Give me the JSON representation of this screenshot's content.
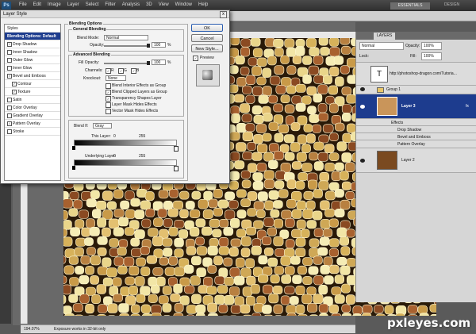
{
  "app": {
    "logo": "Ps",
    "menu": [
      "File",
      "Edit",
      "Image",
      "Layer",
      "Select",
      "Filter",
      "Analysis",
      "3D",
      "View",
      "Window",
      "Help"
    ],
    "workspace_active": "ESSENTIALS",
    "workspace_other": "DESIGN"
  },
  "status": {
    "zoom": "194.07%",
    "message": "Exposure works in 32-bit only"
  },
  "dialog": {
    "title": "Layer Style",
    "close": "x",
    "styles_header": "Styles",
    "styles": [
      {
        "label": "Blending Options: Default",
        "checked": null,
        "selected": true
      },
      {
        "label": "Drop Shadow",
        "checked": true
      },
      {
        "label": "Inner Shadow",
        "checked": false
      },
      {
        "label": "Outer Glow",
        "checked": false
      },
      {
        "label": "Inner Glow",
        "checked": false
      },
      {
        "label": "Bevel and Emboss",
        "checked": true
      },
      {
        "label": "Contour",
        "checked": true,
        "indent": true
      },
      {
        "label": "Texture",
        "checked": true,
        "indent": true
      },
      {
        "label": "Satin",
        "checked": false
      },
      {
        "label": "Color Overlay",
        "checked": false
      },
      {
        "label": "Gradient Overlay",
        "checked": false
      },
      {
        "label": "Pattern Overlay",
        "checked": true
      },
      {
        "label": "Stroke",
        "checked": false
      }
    ],
    "blending_options_title": "Blending Options",
    "general_title": "General Blending",
    "blend_mode_label": "Blend Mode:",
    "blend_mode_value": "Normal",
    "opacity_label": "Opacity:",
    "opacity_value": "100",
    "percent": "%",
    "advanced_title": "Advanced Blending",
    "fill_opacity_label": "Fill Opacity:",
    "fill_opacity_value": "100",
    "channels_label": "Channels:",
    "channels": [
      "R",
      "G",
      "B"
    ],
    "knockout_label": "Knockout:",
    "knockout_value": "None",
    "advanced_checks": [
      {
        "label": "Blend Interior Effects as Group",
        "checked": false
      },
      {
        "label": "Blend Clipped Layers as Group",
        "checked": true
      },
      {
        "label": "Transparency Shapes Layer",
        "checked": true
      },
      {
        "label": "Layer Mask Hides Effects",
        "checked": false
      },
      {
        "label": "Vector Mask Hides Effects",
        "checked": false
      }
    ],
    "blend_if_label": "Blend If:",
    "blend_if_value": "Gray",
    "this_layer_label": "This Layer:",
    "this_layer_min": "0",
    "this_layer_max": "255",
    "underlying_label": "Underlying Layer:",
    "underlying_min": "0",
    "underlying_max": "255",
    "buttons": {
      "ok": "OK",
      "cancel": "Cancel",
      "new_style": "New Style...",
      "preview": "Preview"
    },
    "preview_checked": true
  },
  "layers_panel": {
    "tab": "LAYERS",
    "blend_mode": "Normal",
    "opacity_label": "Opacity:",
    "opacity_value": "100%",
    "lock_label": "Lock:",
    "fill_label": "Fill:",
    "fill_value": "100%",
    "layers": [
      {
        "name": "http://photoshop-dragon.com/Tutoria...",
        "type": "text",
        "thumb_text": "T"
      },
      {
        "name": "Group 1",
        "type": "group"
      },
      {
        "name": "Layer 3",
        "type": "layer",
        "selected": true
      },
      {
        "name": "Effects",
        "type": "effects"
      },
      {
        "name": "Drop Shadow",
        "type": "effect"
      },
      {
        "name": "Bevel and Emboss",
        "type": "effect"
      },
      {
        "name": "Pattern Overlay",
        "type": "effect"
      },
      {
        "name": "Layer 2",
        "type": "layer"
      }
    ]
  },
  "watermark": "pxleyes.com"
}
